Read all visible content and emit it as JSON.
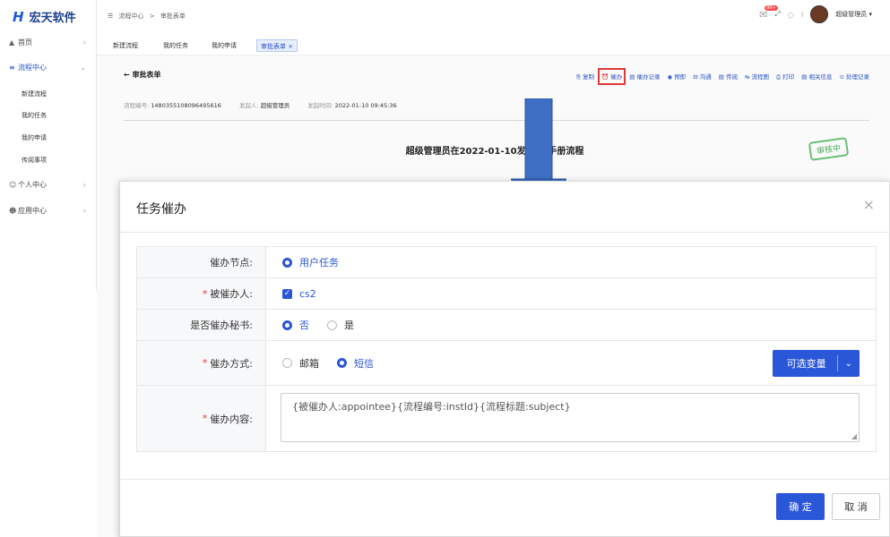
{
  "app": {
    "logo_mark": "H",
    "name": "宏天软件"
  },
  "sidebar": {
    "items": [
      {
        "icon": "▲",
        "label": "首页"
      },
      {
        "icon": "≡",
        "label": "流程中心"
      },
      {
        "icon": "☺",
        "label": "个人中心"
      },
      {
        "icon": "☻",
        "label": "应用中心"
      }
    ],
    "subitems": [
      "新建流程",
      "我的任务",
      "我的申请",
      "传阅事项"
    ]
  },
  "header": {
    "breadcrumb": [
      "☰",
      "流程中心",
      ">",
      "审批表单"
    ],
    "badge": "99+",
    "user": "超级管理员 ▾"
  },
  "tabs": [
    "新建流程",
    "我的任务",
    "我的申请",
    "审批表单 ×"
  ],
  "panel": {
    "back": "← 审批表单",
    "actions": [
      "⎘ 复制",
      "⏰ 催办",
      "▤ 催办记录",
      "◉ 预即",
      "⊟ 沟通",
      "▤ 传阅",
      "⇆ 流程图",
      "⎙ 打印",
      "▤ 相关信息",
      "⊙ 处理记录"
    ],
    "meta": {
      "id_label": "流程编号:",
      "id_value": "1480355108096495616",
      "starter_label": "发起人:",
      "starter_value": "超级管理员",
      "time_label": "发起时间:",
      "time_value": "2022-01-10 09:45:36"
    },
    "doc_title": "超级管理员在2022-01-10发起... 手册流程",
    "stamp": "审核中"
  },
  "dialog": {
    "title": "任务催办",
    "close": "×",
    "rows": {
      "node_label": "催办节点:",
      "node_option": "用户任务",
      "target_label": "被催办人:",
      "target_value": "cs2",
      "secretary_label": "是否催办秘书:",
      "secretary_no": "否",
      "secretary_yes": "是",
      "method_label": "催办方式:",
      "method_email": "邮箱",
      "method_sms": "短信",
      "var_button": "可选变量",
      "content_label": "催办内容:",
      "content_value": "{被催办人:appointee}{流程编号:instId}{流程标题:subject}"
    },
    "ok": "确 定",
    "cancel": "取 消"
  },
  "colors": {
    "primary": "#2a56d8",
    "required": "#e23b3b",
    "arrow": "#3e6fc4"
  }
}
